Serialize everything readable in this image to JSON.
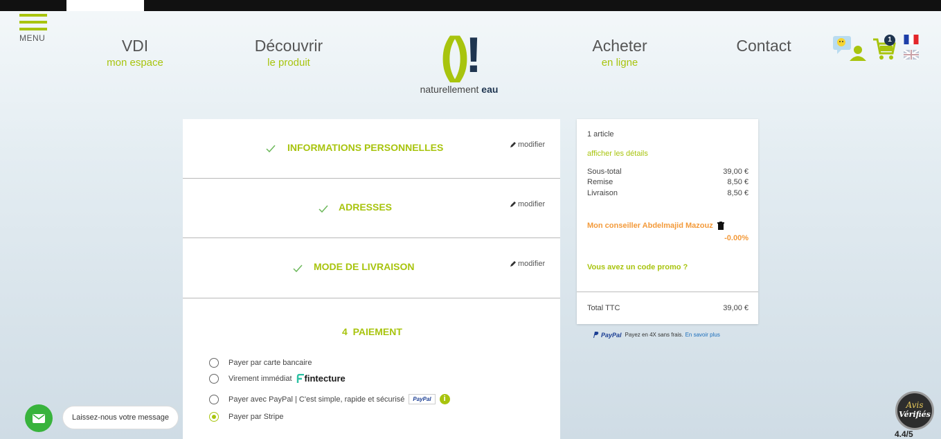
{
  "header": {
    "menu_label": "MENU",
    "nav": [
      {
        "main": "VDI",
        "sub": "mon espace"
      },
      {
        "main": "Découvrir",
        "sub": "le produit"
      },
      {
        "main": "Acheter",
        "sub": "en ligne"
      },
      {
        "main": "Contact",
        "sub": ""
      }
    ],
    "logo": {
      "mark_left": "()",
      "mark_right": "!",
      "tagline_prefix": "naturellement ",
      "tagline_bold": "eau"
    },
    "cart_count": "1"
  },
  "checkout": {
    "steps": [
      {
        "title": "INFORMATIONS PERSONNELLES",
        "modify": "modifier"
      },
      {
        "title": "ADRESSES",
        "modify": "modifier"
      },
      {
        "title": "MODE DE LIVRAISON",
        "modify": "modifier"
      }
    ],
    "payment": {
      "title": "4  PAIEMENT",
      "options": [
        {
          "label": "Payer par carte bancaire",
          "selected": false
        },
        {
          "label": "Virement immédiat",
          "brand": "fintecture",
          "selected": false
        },
        {
          "label": "Payer avec PayPal | C'est simple, rapide et sécurisé",
          "brand": "PayPal",
          "selected": false
        },
        {
          "label": "Payer par Stripe",
          "selected": true
        }
      ]
    }
  },
  "summary": {
    "article_count": "1 article",
    "details_link": "afficher les détails",
    "subtotal_label": "Sous-total",
    "subtotal": "39,00 €",
    "discount_label": "Remise",
    "discount": "8,50 €",
    "shipping_label": "Livraison",
    "shipping": "8,50 €",
    "advisor": "Mon conseiller Abdelmajid Mazouz",
    "advisor_rate": "-0.00%",
    "promo_link": "Vous avez un code promo ?",
    "total_label": "Total TTC",
    "total": "39,00 €"
  },
  "paypal_note": {
    "brand": "PayPal",
    "text": "Payez en 4X sans frais.",
    "link": "En savoir plus"
  },
  "chat": {
    "message": "Laissez-nous votre message"
  },
  "reviews": {
    "badge_title": "Avis",
    "badge_sub": "Vérifiés",
    "score": "4.4/5"
  },
  "colors": {
    "accent": "#a8c40e",
    "navy": "#1f3550",
    "orange": "#f39a3a",
    "chat_green": "#38b33c"
  }
}
